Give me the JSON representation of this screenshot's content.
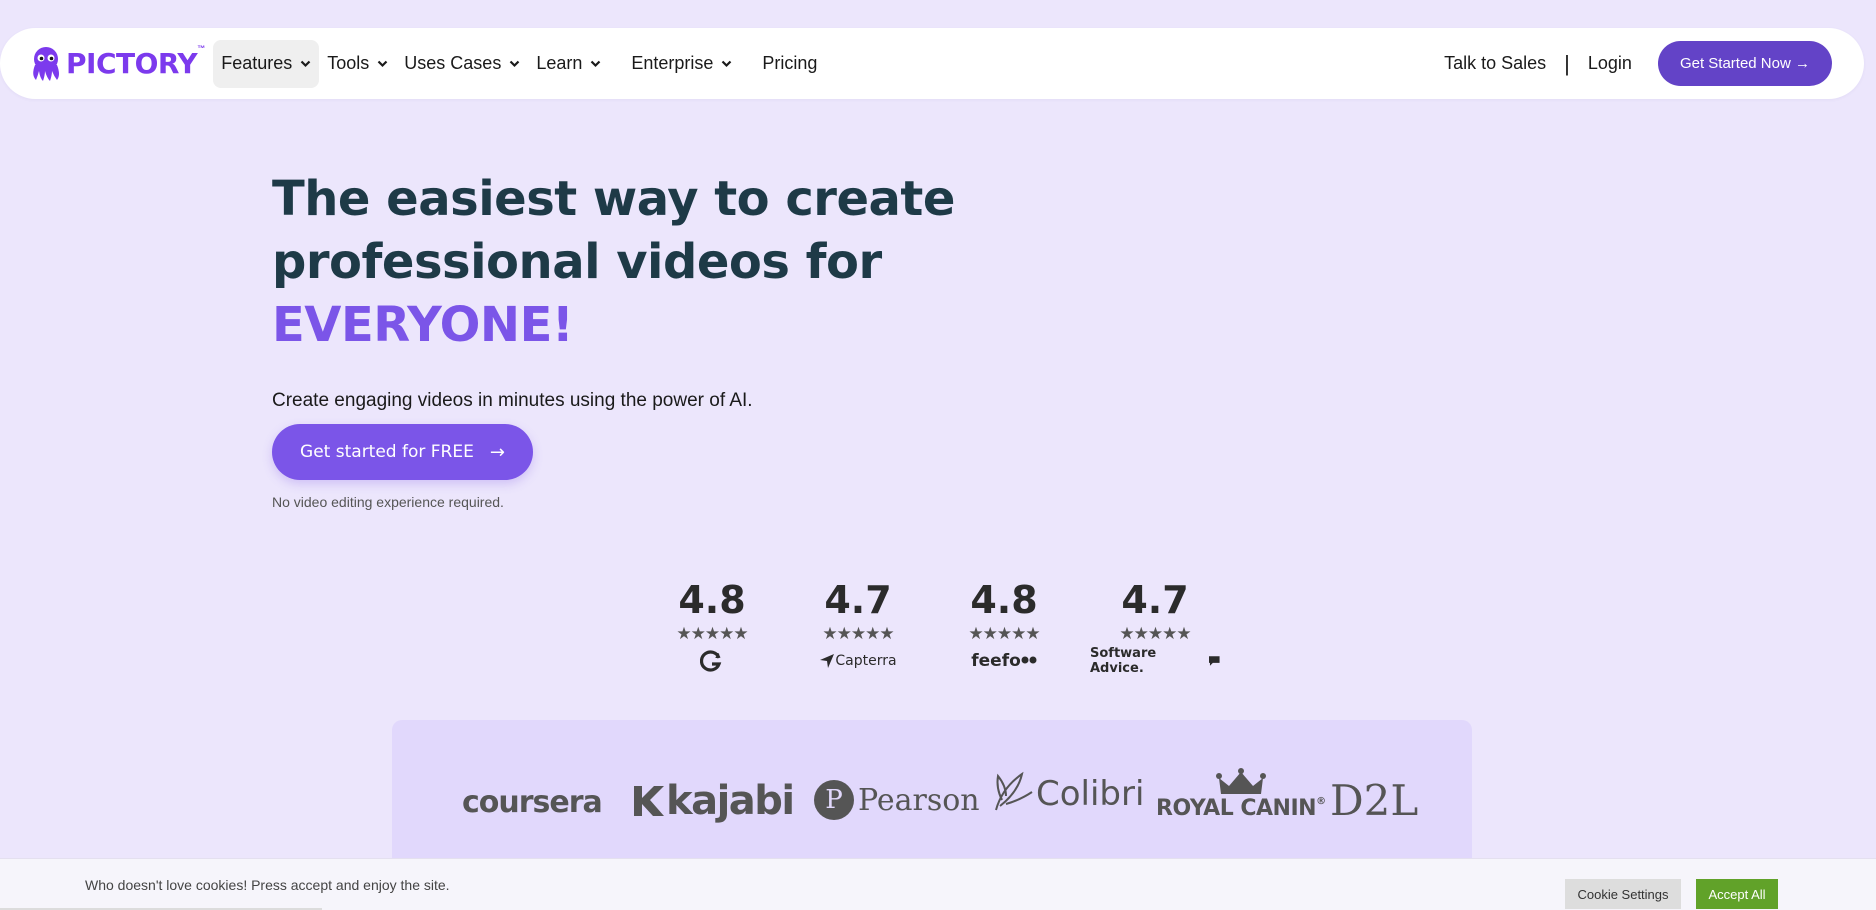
{
  "brand": {
    "name": "PICTORY",
    "tm": "™",
    "color": "#7c3aed"
  },
  "nav": {
    "items": [
      {
        "label": "Features",
        "dropdown": true,
        "active": true
      },
      {
        "label": "Tools",
        "dropdown": true
      },
      {
        "label": "Uses Cases",
        "dropdown": true
      },
      {
        "label": "Learn",
        "dropdown": true
      },
      {
        "label": "Enterprise",
        "dropdown": true
      },
      {
        "label": "Pricing",
        "dropdown": false
      }
    ],
    "talk_to_sales": "Talk to Sales",
    "separator": "|",
    "login": "Login",
    "cta": "Get Started Now →"
  },
  "hero": {
    "title_line1": "The easiest way to create",
    "title_line2": "professional videos for",
    "title_accent": "EVERYONE!",
    "subtitle": "Create engaging videos in minutes using the power of AI.",
    "cta": "Get started for FREE",
    "cta_arrow": "→",
    "note": "No video editing experience required.",
    "accent_color": "#7b55e8"
  },
  "ratings": [
    {
      "value": "4.8",
      "stars": "★★★★★",
      "platform_icon": "g2-icon"
    },
    {
      "value": "4.7",
      "stars": "★★★★★",
      "platform": "Capterra",
      "platform_icon": "capterra-icon"
    },
    {
      "value": "4.8",
      "stars": "★★★★★",
      "platform": "feefo",
      "platform_icon": "feefo-icon"
    },
    {
      "value": "4.7",
      "stars": "★★★★★",
      "platform": "Software Advice.",
      "platform_icon": "software-advice-icon"
    }
  ],
  "logos": {
    "coursera": "coursera",
    "kajabi": "kajabi",
    "pearson_mark": "P",
    "pearson": "Pearson",
    "colibri": "Colibri",
    "royal_canin": "ROYAL CANIN",
    "royal_canin_mark": "®",
    "d2l": "D2L"
  },
  "cookie": {
    "text": "Who doesn't love cookies! Press accept and enjoy the site.",
    "settings": "Cookie Settings",
    "accept": "Accept All",
    "accept_color": "#61a229"
  }
}
